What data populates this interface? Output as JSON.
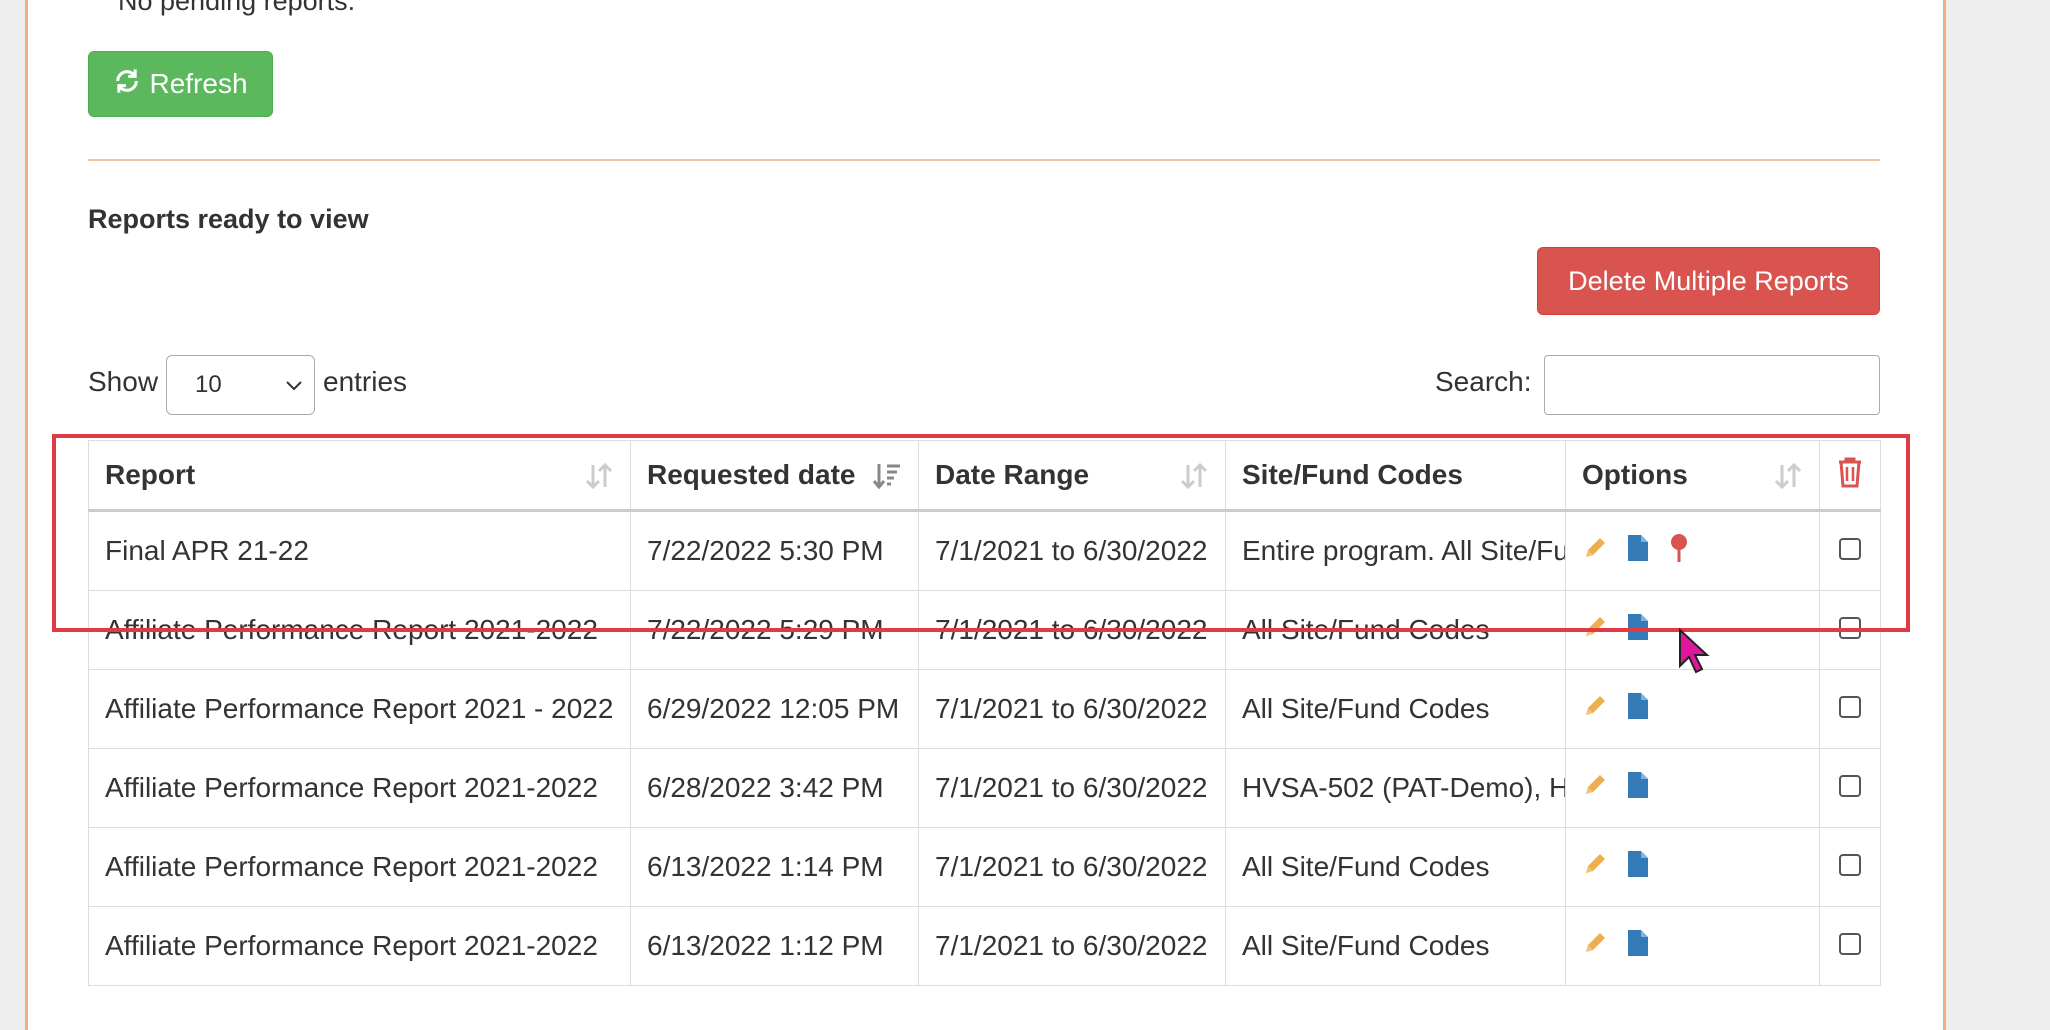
{
  "pending": {
    "text": "No pending reports."
  },
  "refresh_button": {
    "label": "Refresh",
    "icon": "refresh-icon"
  },
  "section": {
    "title": "Reports ready to view"
  },
  "delete_multiple_button": {
    "label": "Delete Multiple Reports"
  },
  "length_control": {
    "show_label": "Show",
    "value": "10",
    "entries_label": "entries"
  },
  "search": {
    "label": "Search:",
    "value": ""
  },
  "table": {
    "columns": [
      "Report",
      "Requested date",
      "Date Range",
      "Site/Fund Codes",
      "Options"
    ],
    "delete_column_icon": "trash-icon",
    "sorted_column": "Requested date",
    "rows": [
      {
        "report": "Final APR 21-22",
        "requested": "7/22/2022 5:30 PM",
        "range": "7/1/2021 to 6/30/2022",
        "codes": "Entire program. All Site/Fund Codes",
        "pin": true
      },
      {
        "report": "Affiliate Performance Report 2021-2022",
        "requested": "7/22/2022 5:29 PM",
        "range": "7/1/2021 to 6/30/2022",
        "codes": "All Site/Fund Codes",
        "pin": false
      },
      {
        "report": "Affiliate Performance Report 2021 - 2022",
        "requested": "6/29/2022 12:05 PM",
        "range": "7/1/2021 to 6/30/2022",
        "codes": "All Site/Fund Codes",
        "pin": false
      },
      {
        "report": "Affiliate Performance Report 2021-2022",
        "requested": "6/28/2022 3:42 PM",
        "range": "7/1/2021 to 6/30/2022",
        "codes": "HVSA-502 (PAT-Demo), H",
        "pin": false
      },
      {
        "report": "Affiliate Performance Report 2021-2022",
        "requested": "6/13/2022 1:14 PM",
        "range": "7/1/2021 to 6/30/2022",
        "codes": "All Site/Fund Codes",
        "pin": false
      },
      {
        "report": "Affiliate Performance Report 2021-2022",
        "requested": "6/13/2022 1:12 PM",
        "range": "7/1/2021 to 6/30/2022",
        "codes": "All Site/Fund Codes",
        "pin": false
      }
    ]
  },
  "colors": {
    "refresh": "#5cb85c",
    "delete": "#d9534f",
    "edit_icon": "#f0ad4e",
    "file_icon": "#337ab7",
    "pin_icon": "#d9534f",
    "highlight": "#e03a44",
    "cursor": "#e0169c"
  }
}
